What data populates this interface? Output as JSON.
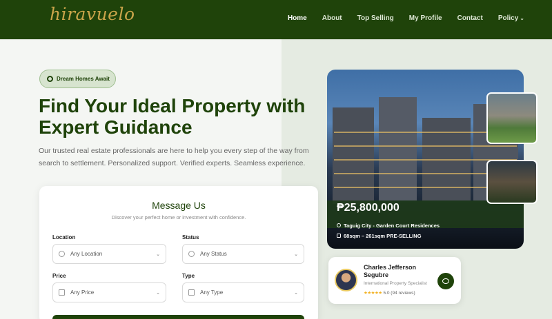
{
  "nav": {
    "logo": "hiravuelo",
    "links": [
      "Home",
      "About",
      "Top Selling",
      "My Profile",
      "Contact",
      "Policy"
    ]
  },
  "hero": {
    "badge": "Dream Homes Await",
    "headline_line1": "Find Your Ideal Property with",
    "headline_line2": "Expert Guidance",
    "subtext": "Our trusted real estate professionals are here to help you every step of the way from search to settlement. Personalized support. Verified experts. Seamless experience."
  },
  "form": {
    "title": "Message Us",
    "subtitle": "Discover your perfect home or investment with confidence.",
    "location_label": "Location",
    "location_value": "Any Location",
    "status_label": "Status",
    "status_value": "Any Status",
    "price_label": "Price",
    "price_value": "Any Price",
    "type_label": "Type",
    "type_value": "Any Type"
  },
  "property": {
    "price": "₱25,800,000",
    "location": "Taguig City - Garden Court Residences",
    "size": "68sqm – 261sqm PRE-SELLING"
  },
  "agent": {
    "name": "Charles Jefferson Segubre",
    "role": "International Property Specialist",
    "stars": "★★★★★",
    "rating": "5.0 (94 reviews)"
  },
  "colors": {
    "brand_green": "#1f430a",
    "accent_gold": "#c9a44a",
    "star": "#f2b01e"
  }
}
